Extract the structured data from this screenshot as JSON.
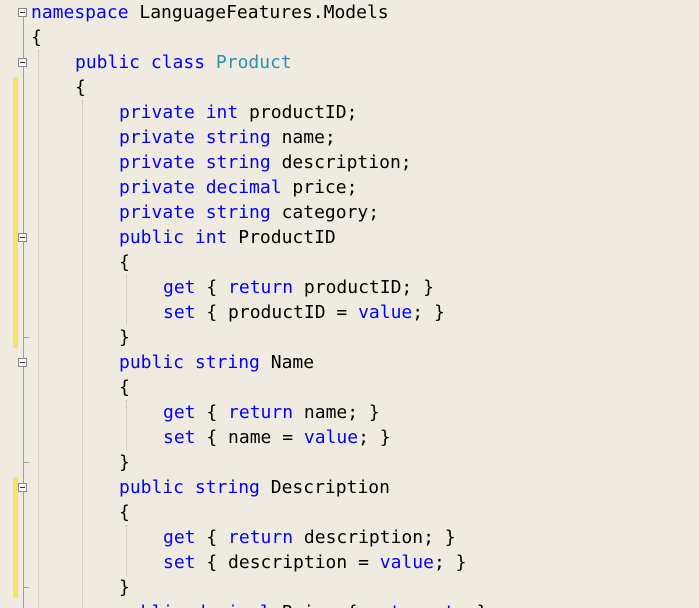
{
  "editor": {
    "lines": [
      {
        "indent": 0,
        "tokens": [
          {
            "t": "namespace",
            "c": "kw"
          },
          {
            "t": " LanguageFeatures.Models",
            "c": "pl"
          }
        ]
      },
      {
        "indent": 0,
        "tokens": [
          {
            "t": "{",
            "c": "pl"
          }
        ]
      },
      {
        "indent": 1,
        "tokens": [
          {
            "t": "public",
            "c": "kw"
          },
          {
            "t": " ",
            "c": "pl"
          },
          {
            "t": "class",
            "c": "kw"
          },
          {
            "t": " ",
            "c": "pl"
          },
          {
            "t": "Product",
            "c": "ty"
          }
        ]
      },
      {
        "indent": 1,
        "tokens": [
          {
            "t": "{",
            "c": "pl"
          }
        ]
      },
      {
        "indent": 2,
        "tokens": [
          {
            "t": "private",
            "c": "kw"
          },
          {
            "t": " ",
            "c": "pl"
          },
          {
            "t": "int",
            "c": "kw"
          },
          {
            "t": " productID;",
            "c": "pl"
          }
        ]
      },
      {
        "indent": 2,
        "tokens": [
          {
            "t": "private",
            "c": "kw"
          },
          {
            "t": " ",
            "c": "pl"
          },
          {
            "t": "string",
            "c": "kw"
          },
          {
            "t": " name;",
            "c": "pl"
          }
        ]
      },
      {
        "indent": 2,
        "tokens": [
          {
            "t": "private",
            "c": "kw"
          },
          {
            "t": " ",
            "c": "pl"
          },
          {
            "t": "string",
            "c": "kw"
          },
          {
            "t": " description;",
            "c": "pl"
          }
        ]
      },
      {
        "indent": 2,
        "tokens": [
          {
            "t": "private",
            "c": "kw"
          },
          {
            "t": " ",
            "c": "pl"
          },
          {
            "t": "decimal",
            "c": "kw"
          },
          {
            "t": " price;",
            "c": "pl"
          }
        ]
      },
      {
        "indent": 2,
        "tokens": [
          {
            "t": "private",
            "c": "kw"
          },
          {
            "t": " ",
            "c": "pl"
          },
          {
            "t": "string",
            "c": "kw"
          },
          {
            "t": " category;",
            "c": "pl"
          }
        ]
      },
      {
        "indent": 2,
        "tokens": [
          {
            "t": "public",
            "c": "kw"
          },
          {
            "t": " ",
            "c": "pl"
          },
          {
            "t": "int",
            "c": "kw"
          },
          {
            "t": " ProductID",
            "c": "pl"
          }
        ]
      },
      {
        "indent": 2,
        "tokens": [
          {
            "t": "{",
            "c": "pl"
          }
        ]
      },
      {
        "indent": 3,
        "tokens": [
          {
            "t": "get",
            "c": "kw"
          },
          {
            "t": " { ",
            "c": "pl"
          },
          {
            "t": "return",
            "c": "kw"
          },
          {
            "t": " productID; }",
            "c": "pl"
          }
        ]
      },
      {
        "indent": 3,
        "tokens": [
          {
            "t": "set",
            "c": "kw"
          },
          {
            "t": " { productID = ",
            "c": "pl"
          },
          {
            "t": "value",
            "c": "kw"
          },
          {
            "t": "; }",
            "c": "pl"
          }
        ]
      },
      {
        "indent": 2,
        "tokens": [
          {
            "t": "}",
            "c": "pl"
          }
        ]
      },
      {
        "indent": 2,
        "tokens": [
          {
            "t": "public",
            "c": "kw"
          },
          {
            "t": " ",
            "c": "pl"
          },
          {
            "t": "string",
            "c": "kw"
          },
          {
            "t": " Name",
            "c": "pl"
          }
        ]
      },
      {
        "indent": 2,
        "tokens": [
          {
            "t": "{",
            "c": "pl"
          }
        ]
      },
      {
        "indent": 3,
        "tokens": [
          {
            "t": "get",
            "c": "kw"
          },
          {
            "t": " { ",
            "c": "pl"
          },
          {
            "t": "return",
            "c": "kw"
          },
          {
            "t": " name; }",
            "c": "pl"
          }
        ]
      },
      {
        "indent": 3,
        "tokens": [
          {
            "t": "set",
            "c": "kw"
          },
          {
            "t": " { name = ",
            "c": "pl"
          },
          {
            "t": "value",
            "c": "kw"
          },
          {
            "t": "; }",
            "c": "pl"
          }
        ]
      },
      {
        "indent": 2,
        "tokens": [
          {
            "t": "}",
            "c": "pl"
          }
        ]
      },
      {
        "indent": 2,
        "tokens": [
          {
            "t": "public",
            "c": "kw"
          },
          {
            "t": " ",
            "c": "pl"
          },
          {
            "t": "string",
            "c": "kw"
          },
          {
            "t": " Description",
            "c": "pl"
          }
        ]
      },
      {
        "indent": 2,
        "tokens": [
          {
            "t": "{",
            "c": "pl"
          }
        ]
      },
      {
        "indent": 3,
        "tokens": [
          {
            "t": "get",
            "c": "kw"
          },
          {
            "t": " { ",
            "c": "pl"
          },
          {
            "t": "return",
            "c": "kw"
          },
          {
            "t": " description; }",
            "c": "pl"
          }
        ]
      },
      {
        "indent": 3,
        "tokens": [
          {
            "t": "set",
            "c": "kw"
          },
          {
            "t": " { description = ",
            "c": "pl"
          },
          {
            "t": "value",
            "c": "kw"
          },
          {
            "t": "; }",
            "c": "pl"
          }
        ]
      },
      {
        "indent": 2,
        "tokens": [
          {
            "t": "}",
            "c": "pl"
          }
        ]
      },
      {
        "indent": 2,
        "tokens": [
          {
            "t": "public",
            "c": "kw"
          },
          {
            "t": " ",
            "c": "pl"
          },
          {
            "t": "decimal",
            "c": "kw"
          },
          {
            "t": " Price { ",
            "c": "pl"
          },
          {
            "t": "get",
            "c": "kw"
          },
          {
            "t": "; ",
            "c": "pl"
          },
          {
            "t": "set",
            "c": "kw"
          },
          {
            "t": "; }",
            "c": "pl"
          }
        ]
      }
    ],
    "collapse_toggles": [
      0,
      2,
      9,
      14,
      19
    ],
    "changed_line_ranges": [
      [
        3,
        13
      ],
      [
        19,
        23
      ]
    ],
    "colors": {
      "background": "#efebe0",
      "keyword": "#0000ff",
      "type": "#2b91af",
      "plain": "#000000",
      "change_marker": "#f2e565"
    }
  }
}
